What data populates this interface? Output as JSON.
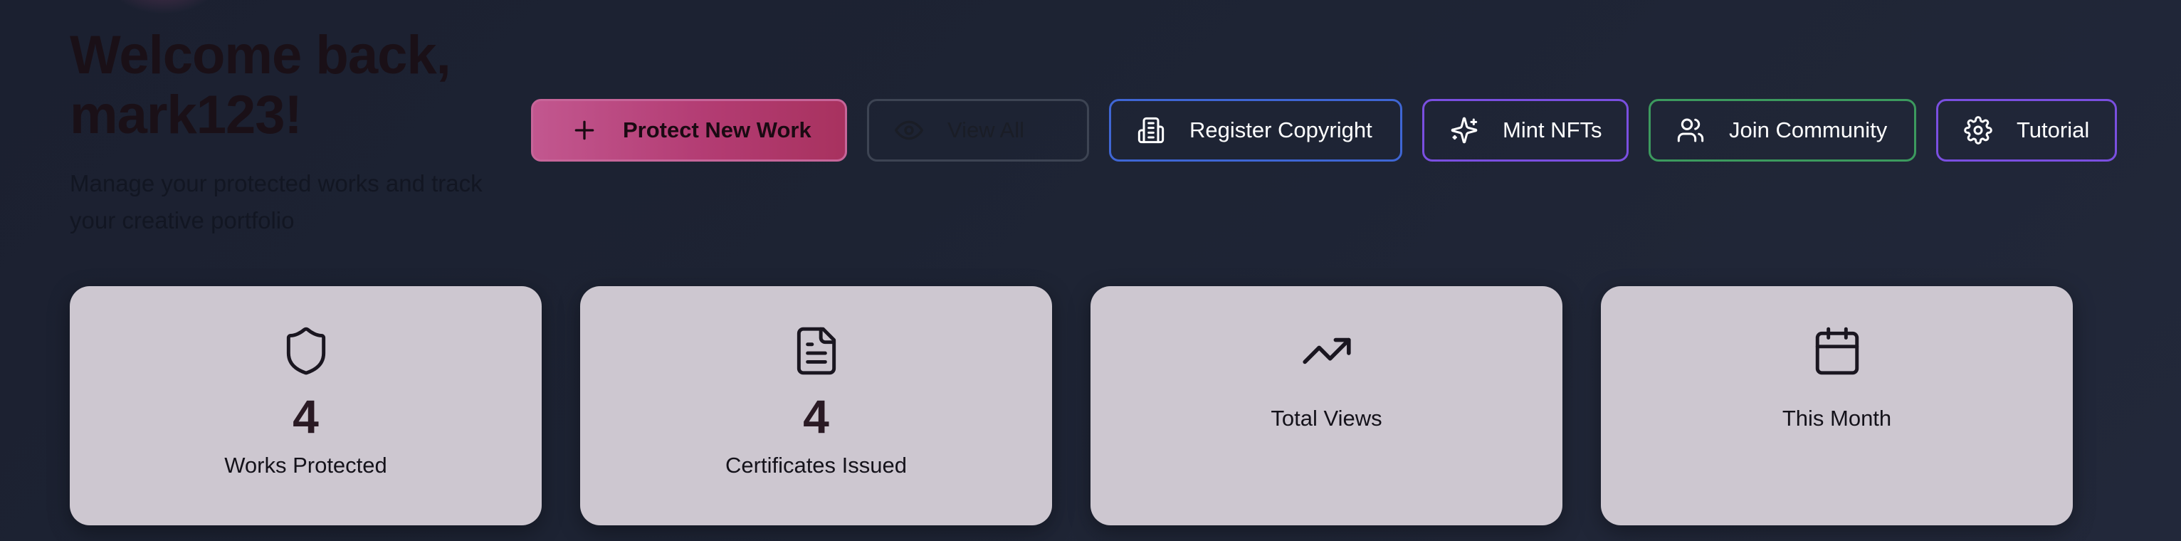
{
  "header": {
    "welcome": "Welcome back, mark123!",
    "subtitle": "Manage your protected works and track your creative portfolio"
  },
  "actions": {
    "protect_new_work": {
      "label": "Protect New Work",
      "icon": "plus-icon"
    },
    "view_all": {
      "label": "View All",
      "icon": "eye-icon"
    },
    "register_copyright": {
      "label": "Register Copyright",
      "icon": "building-icon"
    },
    "mint_nfts": {
      "label": "Mint NFTs",
      "icon": "sparkles-icon"
    },
    "join_community": {
      "label": "Join Community",
      "icon": "users-icon"
    },
    "tutorial": {
      "label": "Tutorial",
      "icon": "gear-icon"
    }
  },
  "stats": {
    "works_protected": {
      "value": "4",
      "label": "Works Protected",
      "icon": "shield-icon"
    },
    "certificates_issued": {
      "value": "4",
      "label": "Certificates Issued",
      "icon": "file-text-icon"
    },
    "total_views": {
      "value": "",
      "label": "Total Views",
      "icon": "trending-up-icon"
    },
    "this_month": {
      "value": "",
      "label": "This Month",
      "icon": "calendar-icon"
    }
  },
  "colors": {
    "background": "#1d2333",
    "primary_gradient_start": "#c2578f",
    "primary_gradient_end": "#a8325f",
    "copyright_border": "#3f66d4",
    "mint_border": "#7a4fe0",
    "community_border": "#3c9a5e",
    "tutorial_border": "#7a4fe0",
    "card_background": "#cdc7d0"
  }
}
